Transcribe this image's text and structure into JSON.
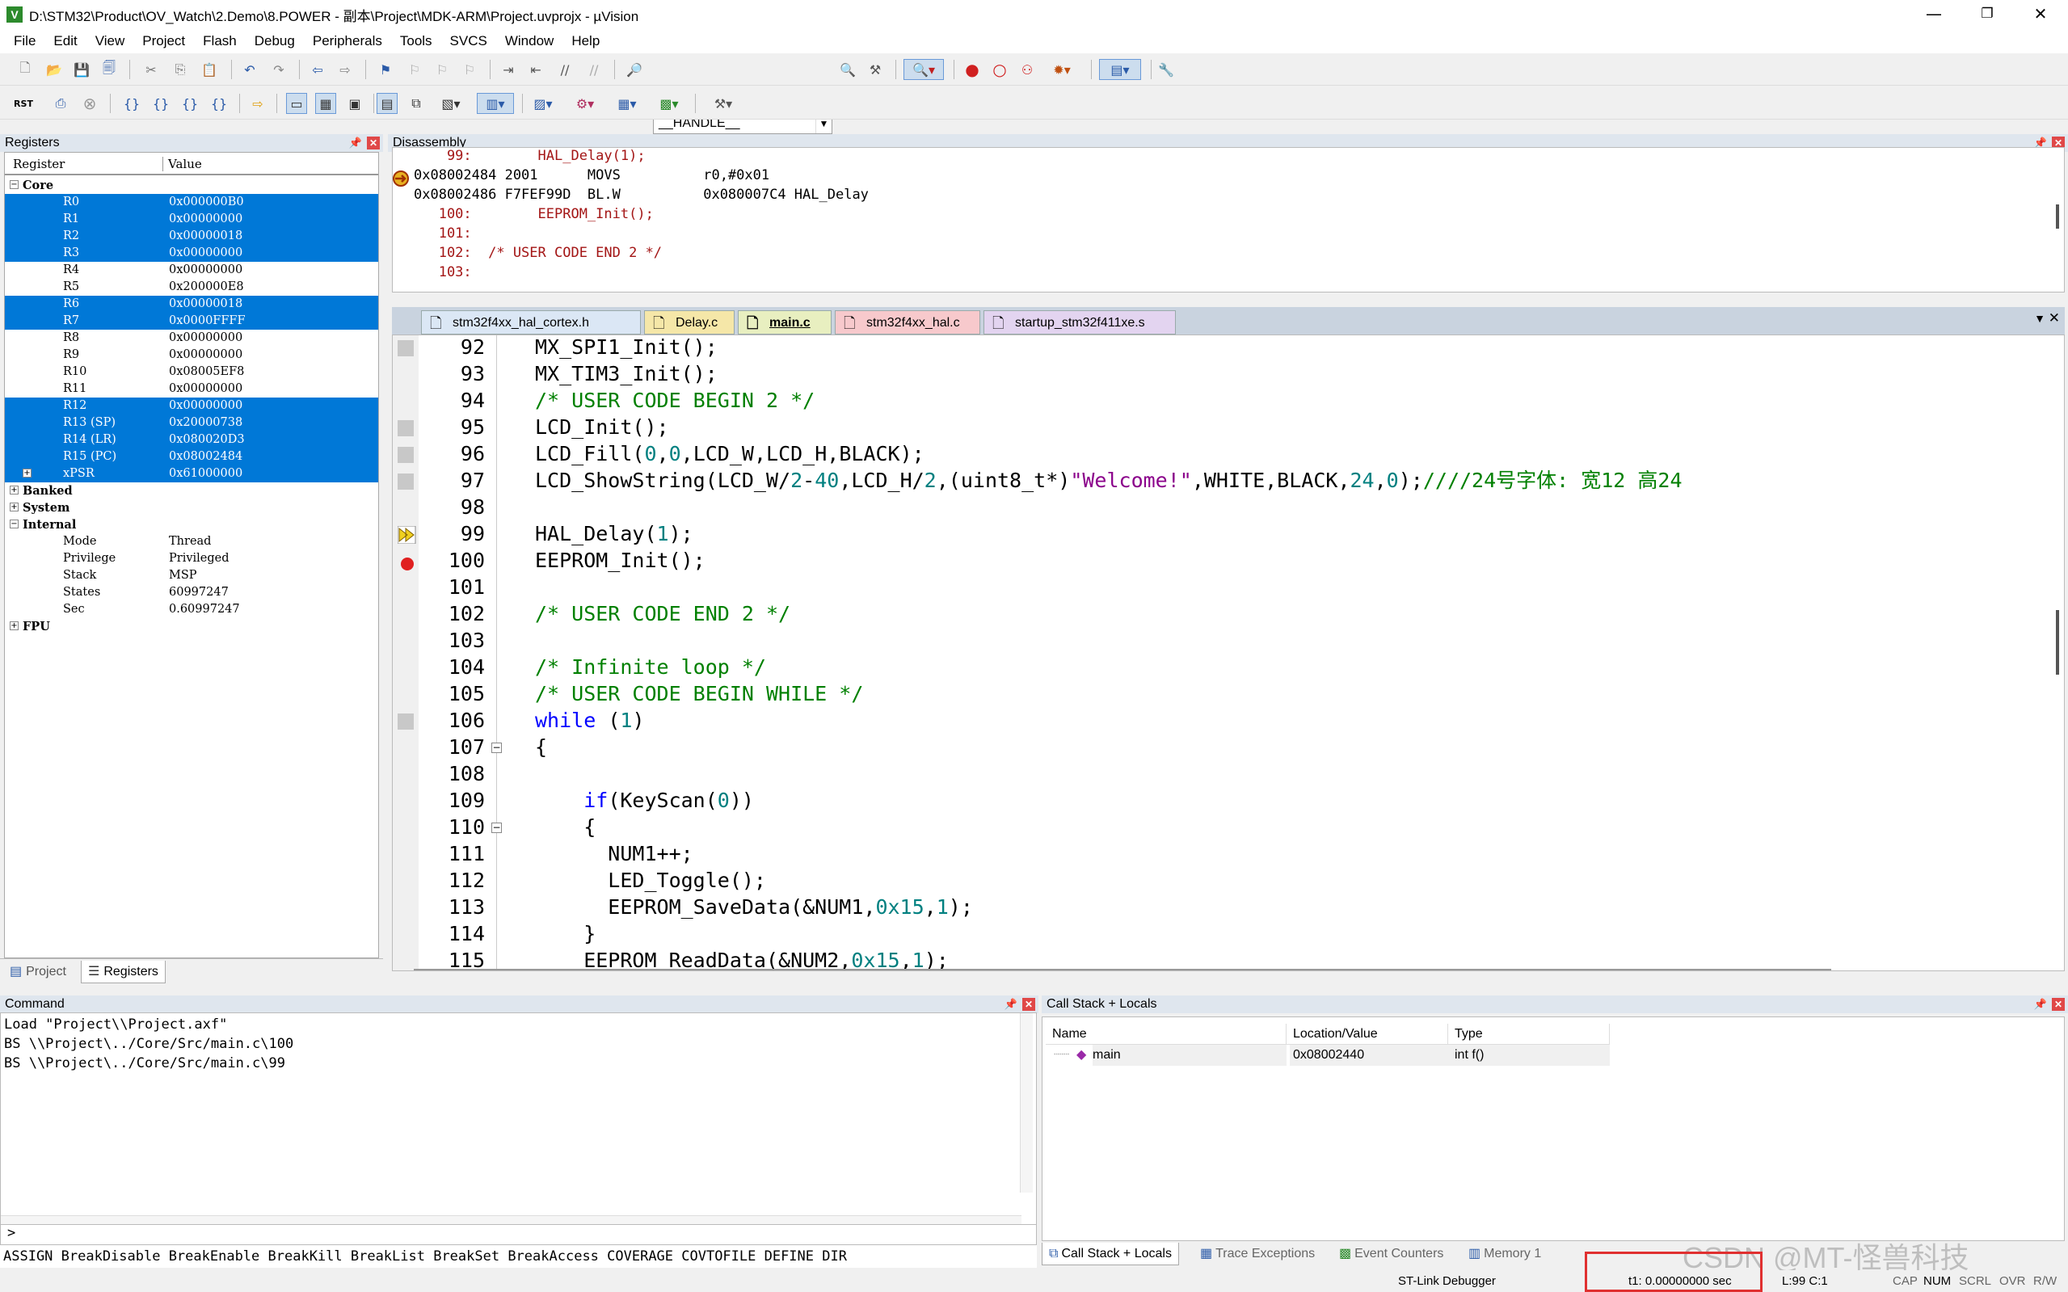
{
  "window": {
    "title": "D:\\STM32\\Product\\OV_Watch\\2.Demo\\8.POWER - 副本\\Project\\MDK-ARM\\Project.uvprojx - µVision",
    "app_icon": "V",
    "minimize": "—",
    "maximize": "❐",
    "close": "✕"
  },
  "menu": [
    "File",
    "Edit",
    "View",
    "Project",
    "Flash",
    "Debug",
    "Peripherals",
    "Tools",
    "SVCS",
    "Window",
    "Help"
  ],
  "toolbar": {
    "combo_value": "__HANDLE__",
    "rst_label": "RST"
  },
  "registers": {
    "title": "Registers",
    "col_register": "Register",
    "col_value": "Value",
    "groups": {
      "core": "Core",
      "banked": "Banked",
      "system": "System",
      "internal": "Internal",
      "fpu": "FPU"
    },
    "core": [
      {
        "name": "R0",
        "value": "0x000000B0",
        "sel": true
      },
      {
        "name": "R1",
        "value": "0x00000000",
        "sel": true
      },
      {
        "name": "R2",
        "value": "0x00000018",
        "sel": true
      },
      {
        "name": "R3",
        "value": "0x00000000",
        "sel": true
      },
      {
        "name": "R4",
        "value": "0x00000000",
        "sel": false
      },
      {
        "name": "R5",
        "value": "0x200000E8",
        "sel": false
      },
      {
        "name": "R6",
        "value": "0x00000018",
        "sel": true
      },
      {
        "name": "R7",
        "value": "0x0000FFFF",
        "sel": true
      },
      {
        "name": "R8",
        "value": "0x00000000",
        "sel": false
      },
      {
        "name": "R9",
        "value": "0x00000000",
        "sel": false
      },
      {
        "name": "R10",
        "value": "0x08005EF8",
        "sel": false
      },
      {
        "name": "R11",
        "value": "0x00000000",
        "sel": false
      },
      {
        "name": "R12",
        "value": "0x00000000",
        "sel": true
      },
      {
        "name": "R13 (SP)",
        "value": "0x20000738",
        "sel": true
      },
      {
        "name": "R14 (LR)",
        "value": "0x080020D3",
        "sel": true
      },
      {
        "name": "R15 (PC)",
        "value": "0x08002484",
        "sel": true
      },
      {
        "name": "xPSR",
        "value": "0x61000000",
        "sel": true
      }
    ],
    "internal": [
      {
        "name": "Mode",
        "value": "Thread"
      },
      {
        "name": "Privilege",
        "value": "Privileged"
      },
      {
        "name": "Stack",
        "value": "MSP"
      },
      {
        "name": "States",
        "value": "60997247"
      },
      {
        "name": "Sec",
        "value": "0.60997247"
      }
    ],
    "tab_project": "Project",
    "tab_registers": "Registers"
  },
  "disassembly": {
    "title": "Disassembly",
    "lines": [
      {
        "text": "    99:        HAL_Delay(1);",
        "type": "src"
      },
      {
        "text": "0x08002484 2001      MOVS          r0,#0x01",
        "type": "asm"
      },
      {
        "text": "0x08002486 F7FEF99D  BL.W          0x080007C4 HAL_Delay",
        "type": "asm"
      },
      {
        "text": "   100:        EEPROM_Init();",
        "type": "src"
      },
      {
        "text": "   101:",
        "type": "src"
      },
      {
        "text": "   102:  /* USER CODE END 2 */",
        "type": "src"
      },
      {
        "text": "   103:",
        "type": "src"
      }
    ]
  },
  "editor_tabs": [
    {
      "label": "stm32f4xx_hal_cortex.h",
      "color": "#dbe7f5"
    },
    {
      "label": "Delay.c",
      "color": "#f5e7a8"
    },
    {
      "label": "main.c",
      "color": "#e8efc0"
    },
    {
      "label": "stm32f4xx_hal.c",
      "color": "#f7c9cc"
    },
    {
      "label": "startup_stm32f411xe.s",
      "color": "#e3d4f0"
    }
  ],
  "editor": {
    "lines": [
      {
        "n": "92",
        "code": [
          [
            "f",
            "MX_SPI1_Init();"
          ]
        ]
      },
      {
        "n": "93",
        "code": [
          [
            "f",
            "MX_TIM3_Init();"
          ]
        ]
      },
      {
        "n": "94",
        "code": [
          [
            "c",
            "/* USER CODE BEGIN 2 */"
          ]
        ]
      },
      {
        "n": "95",
        "code": [
          [
            "f",
            "LCD_Init();"
          ]
        ]
      },
      {
        "n": "96",
        "code": [
          [
            "f",
            "LCD_Fill("
          ],
          [
            "num",
            "0"
          ],
          [
            "f",
            ","
          ],
          [
            "num",
            "0"
          ],
          [
            "f",
            ",LCD_W,LCD_H,BLACK);"
          ]
        ]
      },
      {
        "n": "97",
        "code": [
          [
            "f",
            "LCD_ShowString(LCD_W/"
          ],
          [
            "num",
            "2"
          ],
          [
            "f",
            "-"
          ],
          [
            "num",
            "40"
          ],
          [
            "f",
            ",LCD_H/"
          ],
          [
            "num",
            "2"
          ],
          [
            "f",
            ",(uint8_t*)"
          ],
          [
            "s2",
            "\"Welcome!\""
          ],
          [
            "f",
            ",WHITE,BLACK,"
          ],
          [
            "num",
            "24"
          ],
          [
            "f",
            ","
          ],
          [
            "num",
            "0"
          ],
          [
            "f",
            ");"
          ],
          [
            "c",
            "////24号字体: 宽12 高24"
          ]
        ]
      },
      {
        "n": "98",
        "code": []
      },
      {
        "n": "99",
        "code": [
          [
            "f",
            "HAL_Delay("
          ],
          [
            "num",
            "1"
          ],
          [
            "f",
            ");"
          ]
        ]
      },
      {
        "n": "100",
        "code": [
          [
            "f",
            "EEPROM_Init();"
          ]
        ]
      },
      {
        "n": "101",
        "code": []
      },
      {
        "n": "102",
        "code": [
          [
            "c",
            "/* USER CODE END 2 */"
          ]
        ]
      },
      {
        "n": "103",
        "code": []
      },
      {
        "n": "104",
        "code": [
          [
            "c",
            "/* Infinite loop */"
          ]
        ]
      },
      {
        "n": "105",
        "code": [
          [
            "c",
            "/* USER CODE BEGIN WHILE */"
          ]
        ]
      },
      {
        "n": "106",
        "code": [
          [
            "k",
            "while"
          ],
          [
            "f",
            " ("
          ],
          [
            "num",
            "1"
          ],
          [
            "f",
            ")"
          ]
        ]
      },
      {
        "n": "107",
        "code": [
          [
            "f",
            "{"
          ]
        ]
      },
      {
        "n": "108",
        "code": []
      },
      {
        "n": "109",
        "code": [
          [
            "f",
            "    "
          ],
          [
            "k",
            "if"
          ],
          [
            "f",
            "(KeyScan("
          ],
          [
            "num",
            "0"
          ],
          [
            "f",
            "))"
          ]
        ]
      },
      {
        "n": "110",
        "code": [
          [
            "f",
            "    {"
          ]
        ]
      },
      {
        "n": "111",
        "code": [
          [
            "f",
            "      NUM1++;"
          ]
        ]
      },
      {
        "n": "112",
        "code": [
          [
            "f",
            "      LED_Toggle();"
          ]
        ]
      },
      {
        "n": "113",
        "code": [
          [
            "f",
            "      EEPROM_SaveData(&NUM1,"
          ],
          [
            "num",
            "0x15"
          ],
          [
            "f",
            ","
          ],
          [
            "num",
            "1"
          ],
          [
            "f",
            ");"
          ]
        ]
      },
      {
        "n": "114",
        "code": [
          [
            "f",
            "    }"
          ]
        ]
      },
      {
        "n": "115",
        "code": [
          [
            "f",
            "    EEPROM_ReadData(&NUM2,"
          ],
          [
            "num",
            "0x15"
          ],
          [
            "f",
            ","
          ],
          [
            "num",
            "1"
          ],
          [
            "f",
            ");"
          ]
        ]
      }
    ]
  },
  "command": {
    "title": "Command",
    "lines": [
      "Load \"Project\\\\Project.axf\"",
      "BS \\\\Project\\../Core/Src/main.c\\100",
      "BS \\\\Project\\../Core/Src/main.c\\99"
    ],
    "prompt": ">",
    "help": "ASSIGN BreakDisable BreakEnable BreakKill BreakList BreakSet BreakAccess COVERAGE COVTOFILE DEFINE DIR"
  },
  "callstack": {
    "title": "Call Stack + Locals",
    "col_name": "Name",
    "col_location": "Location/Value",
    "col_type": "Type",
    "rows": [
      {
        "name": "main",
        "location": "0x08002440",
        "type": "int f()"
      }
    ],
    "tabs": [
      "Call Stack + Locals",
      "Trace Exceptions",
      "Event Counters",
      "Memory 1"
    ]
  },
  "status": {
    "debugger": "ST-Link Debugger",
    "t1": "t1: 0.00000000 sec",
    "pos": "L:99 C:1",
    "caps": "CAP",
    "num": "NUM",
    "scrl": "SCRL",
    "ovr": "OVR",
    "rw": "R/W"
  },
  "watermark": "CSDN @MT-怪兽科技",
  "colors": {
    "selection": "#0078d7",
    "keyword": "#0000ff",
    "comment": "#008000",
    "number": "#008080",
    "string": "#8b008b",
    "highlight_box": "#e03030"
  }
}
